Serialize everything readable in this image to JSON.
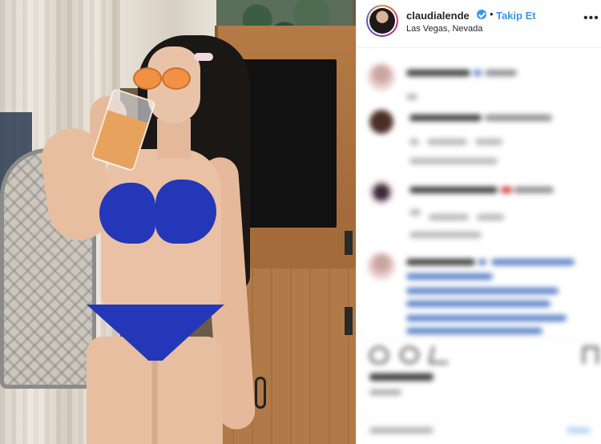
{
  "post": {
    "username": "claudialende",
    "follow_label": "Takip Et",
    "separator": "•",
    "location": "Las Vegas, Nevada",
    "more_label": "•••"
  },
  "colors": {
    "accent": "#3897f0",
    "text": "#262626",
    "border": "#efefef",
    "bikini": "#2437b8"
  },
  "icons": [
    "verified-badge-icon",
    "more-options-icon",
    "heart-icon",
    "comment-icon",
    "share-icon",
    "save-icon"
  ]
}
